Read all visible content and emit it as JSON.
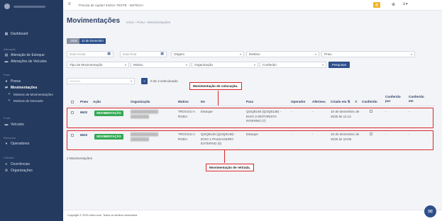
{
  "sidebar": {
    "dashboard": "Dashboard",
    "section_alteracao": "Alteração",
    "alteracao_estoque": "Alteração de Estoque",
    "alteracao_veiculos": "Alterações de Veículos",
    "section_pneu": "Pneu",
    "pneus": "Pneus",
    "movimentacoes": "Movimentações",
    "motivos_movimentacoes": "Motivos de Movimentações",
    "motivos_descarte": "Motivos de Descarte",
    "section_frota": "Frota",
    "veiculos": "Veículos",
    "section_recursos": "Recursos",
    "operadores": "Operadores",
    "section_clientes": "Clientes",
    "ocorrencias": "Ocorrências",
    "organizacoes": "Organizações"
  },
  "topbar": {
    "help": "Precisa de Ajuda? ▾",
    "system": "SIGA TESTE - NSTECH"
  },
  "page": {
    "title": "Movimentações",
    "breadcrumb": "Início  ›  Pneu  ›  Movimentações"
  },
  "tags": [
    "- 2025",
    "10 de Dezembro"
  ],
  "filters": {
    "data_inicial": "Data inicial",
    "data_final": "Data final",
    "origem": "Origem",
    "destino": "Destino",
    "pneu": "Pneu",
    "tipo_movimentacao": "Tipo de Movimentação",
    "motivo": "Motivo",
    "organizacao": "Organização",
    "conferido": "Conferido",
    "search_button": "Pesquisar"
  },
  "bulk": {
    "select_value": "----------",
    "go_label": "»",
    "selected_count": "0 de 2 selecionado"
  },
  "table": {
    "headers": {
      "pneu": "Pneu",
      "acao": "Ação",
      "organizacao": "Organização",
      "motivo": "Motivo",
      "de": "De",
      "para": "Para",
      "operador": "Operador",
      "aferiu": "Aferineu",
      "criado_em": "Criado em ⇅",
      "conferido": "Conferido",
      "conferido_por": "Conferido por",
      "conferido_em": "Conferido em"
    },
    "rows": [
      {
        "pneu": "6622",
        "acao": "MOVIMENTAÇÃO",
        "organizacao": "████████████ ████████",
        "motivo": "TROCOU A RODA",
        "de": "Estoque",
        "para": "QOQ8148 (QOQ8148) - EIXO 3 MOTORISTA INTERNO (7)",
        "operador": "-",
        "aferiu": "-",
        "criado_em": "10 de Dezembro de 2025 às 11:14",
        "conferido_por": "-",
        "conferido_em": "-"
      },
      {
        "pneu": "6622",
        "acao": "MOVIMENTAÇÃO",
        "organizacao": "████████████ ████████",
        "motivo": "TROCOU A RODA",
        "de": "QOQ8148 (QOQ8148) - EIXO 1 PASSAGEIRO EXTERNO (0)",
        "para": "Estoque",
        "operador": "-",
        "aferiu": "-",
        "criado_em": "10 de Dezembro de 2025 às 10:06",
        "conferido_por": "-",
        "conferido_em": "-"
      }
    ],
    "total": "2 Movimentações"
  },
  "annotations": {
    "colocacao": "Movimentação de colocação.",
    "retirada": "Movimentação de retirada."
  },
  "footer": "Copyright © 2025 nstec.com. Todos os direitos reservados",
  "colors": {
    "sidebar": "#243a5e",
    "primary": "#2d4f8c",
    "success": "#33a853",
    "annotation": "#d9262b"
  }
}
